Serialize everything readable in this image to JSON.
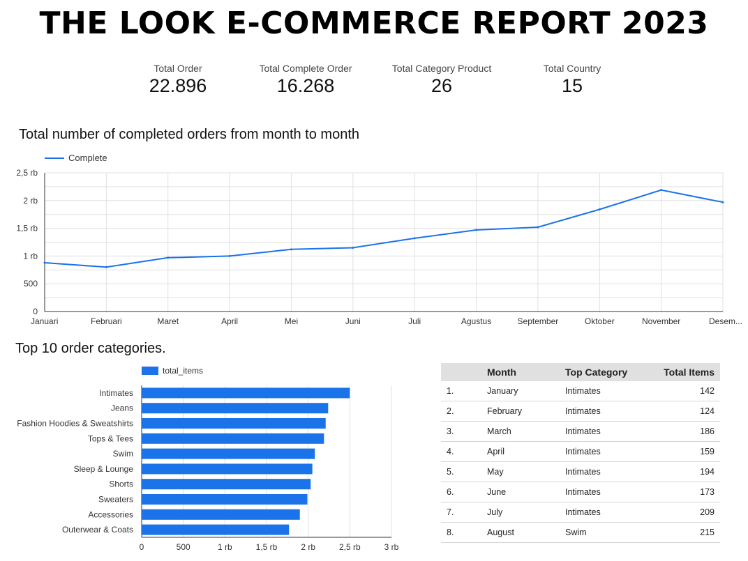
{
  "title": "THE LOOK E-COMMERCE REPORT 2023",
  "kpis": [
    {
      "label": "Total Order",
      "value": "22.896"
    },
    {
      "label": "Total Complete Order",
      "value": "16.268"
    },
    {
      "label": "Total Category Product",
      "value": "26"
    },
    {
      "label": "Total Country",
      "value": "15"
    }
  ],
  "line_section": {
    "title": "Total number of completed orders from month to month",
    "legend": "Complete"
  },
  "bar_section": {
    "title": "Top 10 order categories.",
    "legend": "total_items"
  },
  "table": {
    "headers": [
      "Month",
      "Top Category",
      "Total Items"
    ],
    "rows": [
      {
        "no": "1.",
        "month": "January",
        "category": "Intimates",
        "total": "142"
      },
      {
        "no": "2.",
        "month": "February",
        "category": "Intimates",
        "total": "124"
      },
      {
        "no": "3.",
        "month": "March",
        "category": "Intimates",
        "total": "186"
      },
      {
        "no": "4.",
        "month": "April",
        "category": "Intimates",
        "total": "159"
      },
      {
        "no": "5.",
        "month": "May",
        "category": "Intimates",
        "total": "194"
      },
      {
        "no": "6.",
        "month": "June",
        "category": "Intimates",
        "total": "173"
      },
      {
        "no": "7.",
        "month": "July",
        "category": "Intimates",
        "total": "209"
      },
      {
        "no": "8.",
        "month": "August",
        "category": "Swim",
        "total": "215"
      }
    ]
  },
  "chart_data": [
    {
      "type": "line",
      "title": "Total number of completed orders from month to month",
      "categories": [
        "Januari",
        "Februari",
        "Maret",
        "April",
        "Mei",
        "Juni",
        "Juli",
        "Agustus",
        "September",
        "Oktober",
        "November",
        "Desem..."
      ],
      "series": [
        {
          "name": "Complete",
          "values": [
            880,
            800,
            970,
            1000,
            1120,
            1150,
            1320,
            1470,
            1520,
            1840,
            2190,
            1970
          ]
        }
      ],
      "ylim": [
        0,
        2500
      ],
      "yticks": [
        0,
        500,
        1000,
        1500,
        2000,
        2500
      ],
      "ytick_labels": [
        "0",
        "500",
        "1 rb",
        "1,5 rb",
        "2 rb",
        "2,5 rb"
      ],
      "grid": true,
      "legend_position": "top-left",
      "color": "#1a73e8"
    },
    {
      "type": "bar",
      "orientation": "horizontal",
      "title": "Top 10 order categories.",
      "categories": [
        "Intimates",
        "Jeans",
        "Fashion Hoodies & Sweatshirts",
        "Tops & Tees",
        "Swim",
        "Sleep & Lounge",
        "Shorts",
        "Sweaters",
        "Accessories",
        "Outerwear & Coats"
      ],
      "series": [
        {
          "name": "total_items",
          "values": [
            2500,
            2240,
            2210,
            2190,
            2080,
            2050,
            2030,
            1990,
            1900,
            1770
          ]
        }
      ],
      "xlim": [
        0,
        3000
      ],
      "xticks": [
        0,
        500,
        1000,
        1500,
        2000,
        2500,
        3000
      ],
      "xtick_labels": [
        "0",
        "500",
        "1 rb",
        "1,5 rb",
        "2 rb",
        "2,5 rb",
        "3 rb"
      ],
      "grid": true,
      "legend_position": "top-left",
      "color": "#1a73e8"
    }
  ]
}
